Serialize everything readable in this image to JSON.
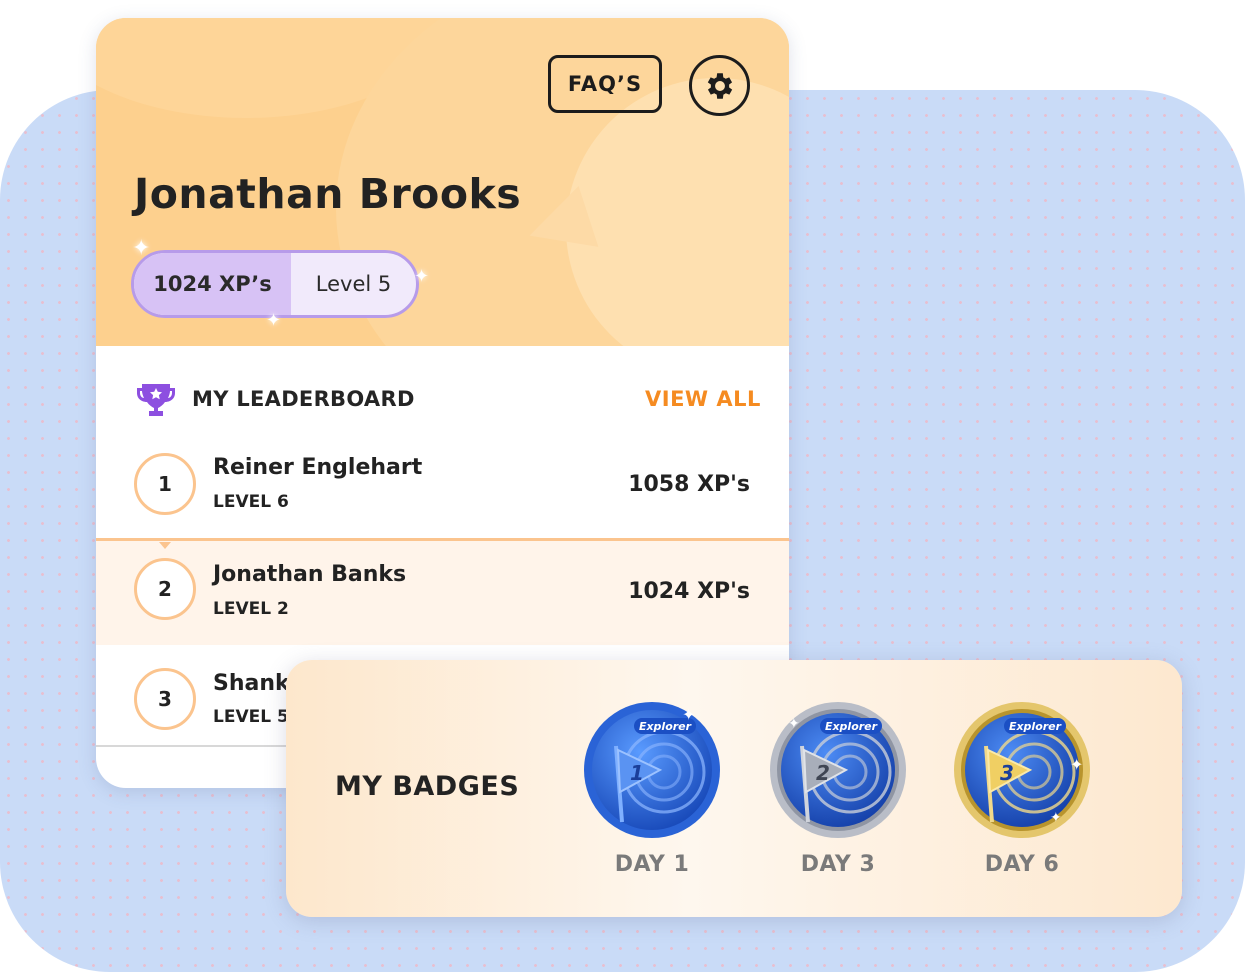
{
  "header": {
    "faq_label": "FAQ’S",
    "user_name": "Jonathan Brooks",
    "xp": "1024 XP’s",
    "level": "Level 5"
  },
  "leaderboard": {
    "title": "MY LEADERBOARD",
    "view_all": "VIEW ALL",
    "rows": [
      {
        "rank": "1",
        "name": "Reiner Englehart",
        "level": "LEVEL 6",
        "xp": "1058 XP's"
      },
      {
        "rank": "2",
        "name": "Jonathan Banks",
        "level": "LEVEL 2",
        "xp": "1024 XP's"
      },
      {
        "rank": "3",
        "name": "Shank",
        "level": "LEVEL 5",
        "xp": ""
      }
    ]
  },
  "badges": {
    "title": "MY BADGES",
    "items": [
      {
        "tag": "Explorer",
        "number": "1",
        "label": "DAY 1",
        "tier": "blue"
      },
      {
        "tag": "Explorer",
        "number": "2",
        "label": "DAY 3",
        "tier": "silver"
      },
      {
        "tag": "Explorer",
        "number": "3",
        "label": "DAY 6",
        "tier": "gold"
      }
    ]
  },
  "colors": {
    "header_bg": "#fdd08e",
    "accent_orange": "#f58b21",
    "xp_pill_border": "#b79be9",
    "trophy_purple": "#8d4fe0",
    "page_bg": "#c9dbf7"
  }
}
